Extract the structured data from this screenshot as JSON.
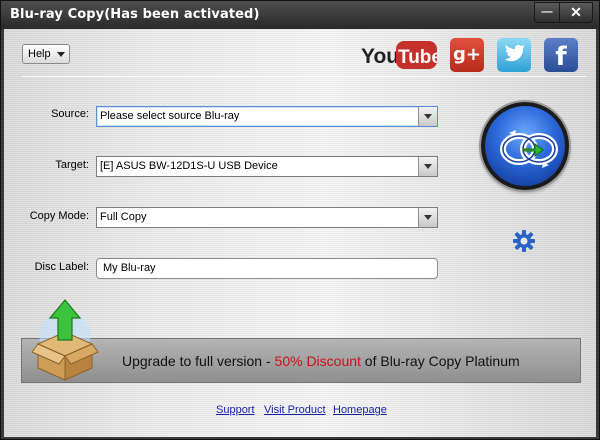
{
  "window": {
    "title": "Blu-ray Copy(Has been activated)",
    "minimize_symbol": "—",
    "close_symbol": "✕"
  },
  "toolbar": {
    "help_label": "Help"
  },
  "social": {
    "youtube_you": "You",
    "youtube_tube": "Tube",
    "googleplus": "g+",
    "facebook": "f"
  },
  "form": {
    "source_label": "Source:",
    "source_value": "Please select source Blu-ray",
    "target_label": "Target:",
    "target_value": "[E] ASUS BW-12D1S-U USB Device",
    "copy_mode_label": "Copy Mode:",
    "copy_mode_value": "Full Copy",
    "disc_label_label": "Disc Label:",
    "disc_label_value": "My Blu-ray"
  },
  "banner": {
    "prefix": "Upgrade to full version - ",
    "discount": "50% Discount",
    "suffix": " of Blu-ray Copy Platinum"
  },
  "footer": {
    "support": "Support",
    "visit_product": "Visit Product",
    "homepage": "Homepage"
  },
  "colors": {
    "discount": "#c8131a",
    "link": "#1a24a8",
    "copy_button": "#2a67d8"
  },
  "icons": {
    "copy": "copy-disc-icon",
    "settings": "gear-icon",
    "upgrade": "upgrade-box-icon"
  }
}
